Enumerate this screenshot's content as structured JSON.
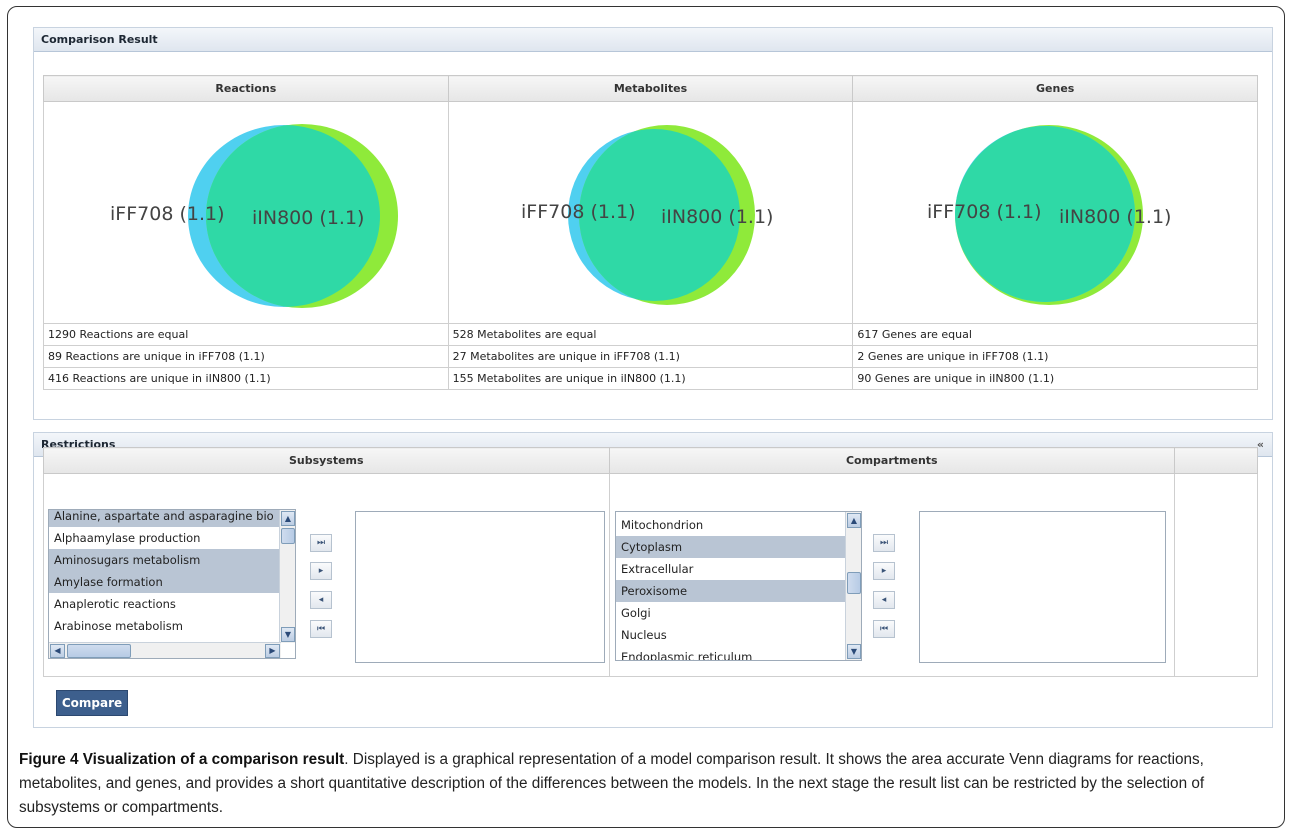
{
  "comparison": {
    "panel_title": "Comparison Result",
    "columns": [
      "Reactions",
      "Metabolites",
      "Genes"
    ],
    "venns": [
      {
        "left_label": "iFF708 (1.1)",
        "right_label": "iIN800 (1.1)"
      },
      {
        "left_label": "iFF708 (1.1)",
        "right_label": "iIN800 (1.1)"
      },
      {
        "left_label": "iFF708 (1.1)",
        "right_label": "iIN800 (1.1)"
      }
    ],
    "stats": [
      [
        "1290 Reactions are equal",
        "528 Metabolites are equal",
        "617 Genes are equal"
      ],
      [
        "89 Reactions are unique in iFF708 (1.1)",
        "27 Metabolites are unique in iFF708 (1.1)",
        "2 Genes are unique in iFF708 (1.1)"
      ],
      [
        "416 Reactions are unique in iIN800 (1.1)",
        "155 Metabolites are unique in iIN800 (1.1)",
        "90 Genes are unique in iIN800 (1.1)"
      ]
    ]
  },
  "restrictions": {
    "panel_title": "Restrictions",
    "collapse_glyph": "«",
    "subsystems_header": "Subsystems",
    "compartments_header": "Compartments",
    "subsystems": [
      {
        "label": "Alanine, aspartate and asparagine bio",
        "selected": true
      },
      {
        "label": "Alphaamylase production",
        "selected": false
      },
      {
        "label": "Aminosugars metabolism",
        "selected": true
      },
      {
        "label": "Amylase formation",
        "selected": true
      },
      {
        "label": "Anaplerotic reactions",
        "selected": false
      },
      {
        "label": "Arabinose metabolism",
        "selected": false
      }
    ],
    "compartments": [
      {
        "label": "Mitochondrion",
        "selected": false
      },
      {
        "label": "Cytoplasm",
        "selected": true
      },
      {
        "label": "Extracellular",
        "selected": false
      },
      {
        "label": "Peroxisome",
        "selected": true
      },
      {
        "label": "Golgi",
        "selected": false
      },
      {
        "label": "Nucleus",
        "selected": false
      },
      {
        "label": "Endoplasmic reticulum",
        "selected": false
      }
    ],
    "move_buttons": [
      "⏭",
      "▸",
      "◂",
      "⏮"
    ],
    "compare_label": "Compare"
  },
  "caption": {
    "title": "Figure 4 Visualization of a comparison result",
    "body": ". Displayed is a graphical representation of a model comparison result. It shows the area accurate Venn diagrams for reactions, metabolites, and genes, and provides a short quantitative description of the differences between the models. In the next stage the result list can be restricted by the selection of subsystems or compartments."
  },
  "colors": {
    "left_set": "#4fd0f0",
    "right_set": "#8fea3a",
    "overlap": "#2fd9a6",
    "button": "#3d5f8d",
    "selection": "#b9c5d4"
  },
  "icons": {
    "first": "skip-first-icon",
    "prev": "move-left-icon",
    "next": "move-right-icon",
    "last": "skip-last-icon",
    "up": "scroll-up-icon",
    "down": "scroll-down-icon"
  }
}
